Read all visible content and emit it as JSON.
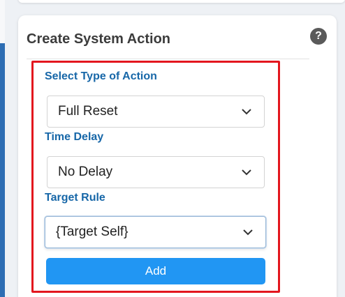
{
  "card": {
    "title": "Create System Action",
    "help_icon_text": "?"
  },
  "form": {
    "action_type": {
      "label": "Select Type of Action",
      "value": "Full Reset"
    },
    "time_delay": {
      "label": "Time Delay",
      "value": "No Delay"
    },
    "target_rule": {
      "label": "Target Rule",
      "value": "{Target Self}"
    },
    "add_button_label": "Add"
  },
  "colors": {
    "label": "#1767a8",
    "highlight": "#e3161e",
    "button": "#2196f3"
  },
  "icons": {
    "help": "question-circle-icon",
    "dropdown": "chevron-down-icon"
  }
}
